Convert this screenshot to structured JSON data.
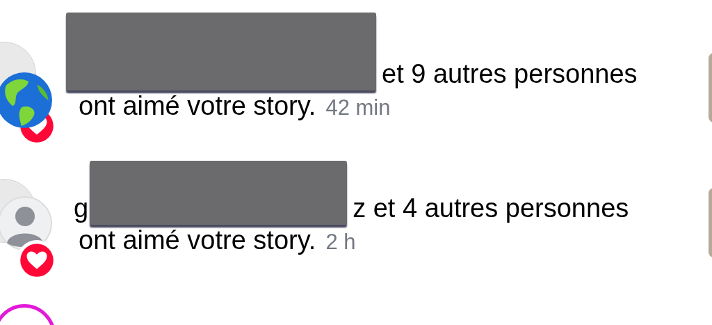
{
  "notifications": [
    {
      "avatar": {
        "kind": "globe"
      },
      "line_1": "et 9 autres personnes",
      "line_2": "ont aimé votre story.",
      "time": "42 min"
    },
    {
      "avatar": {
        "kind": "default"
      },
      "name_start": "g",
      "line_1": "z et 4 autres personnes",
      "line_2": "ont aimé votre story.",
      "time": "2 h"
    }
  ]
}
